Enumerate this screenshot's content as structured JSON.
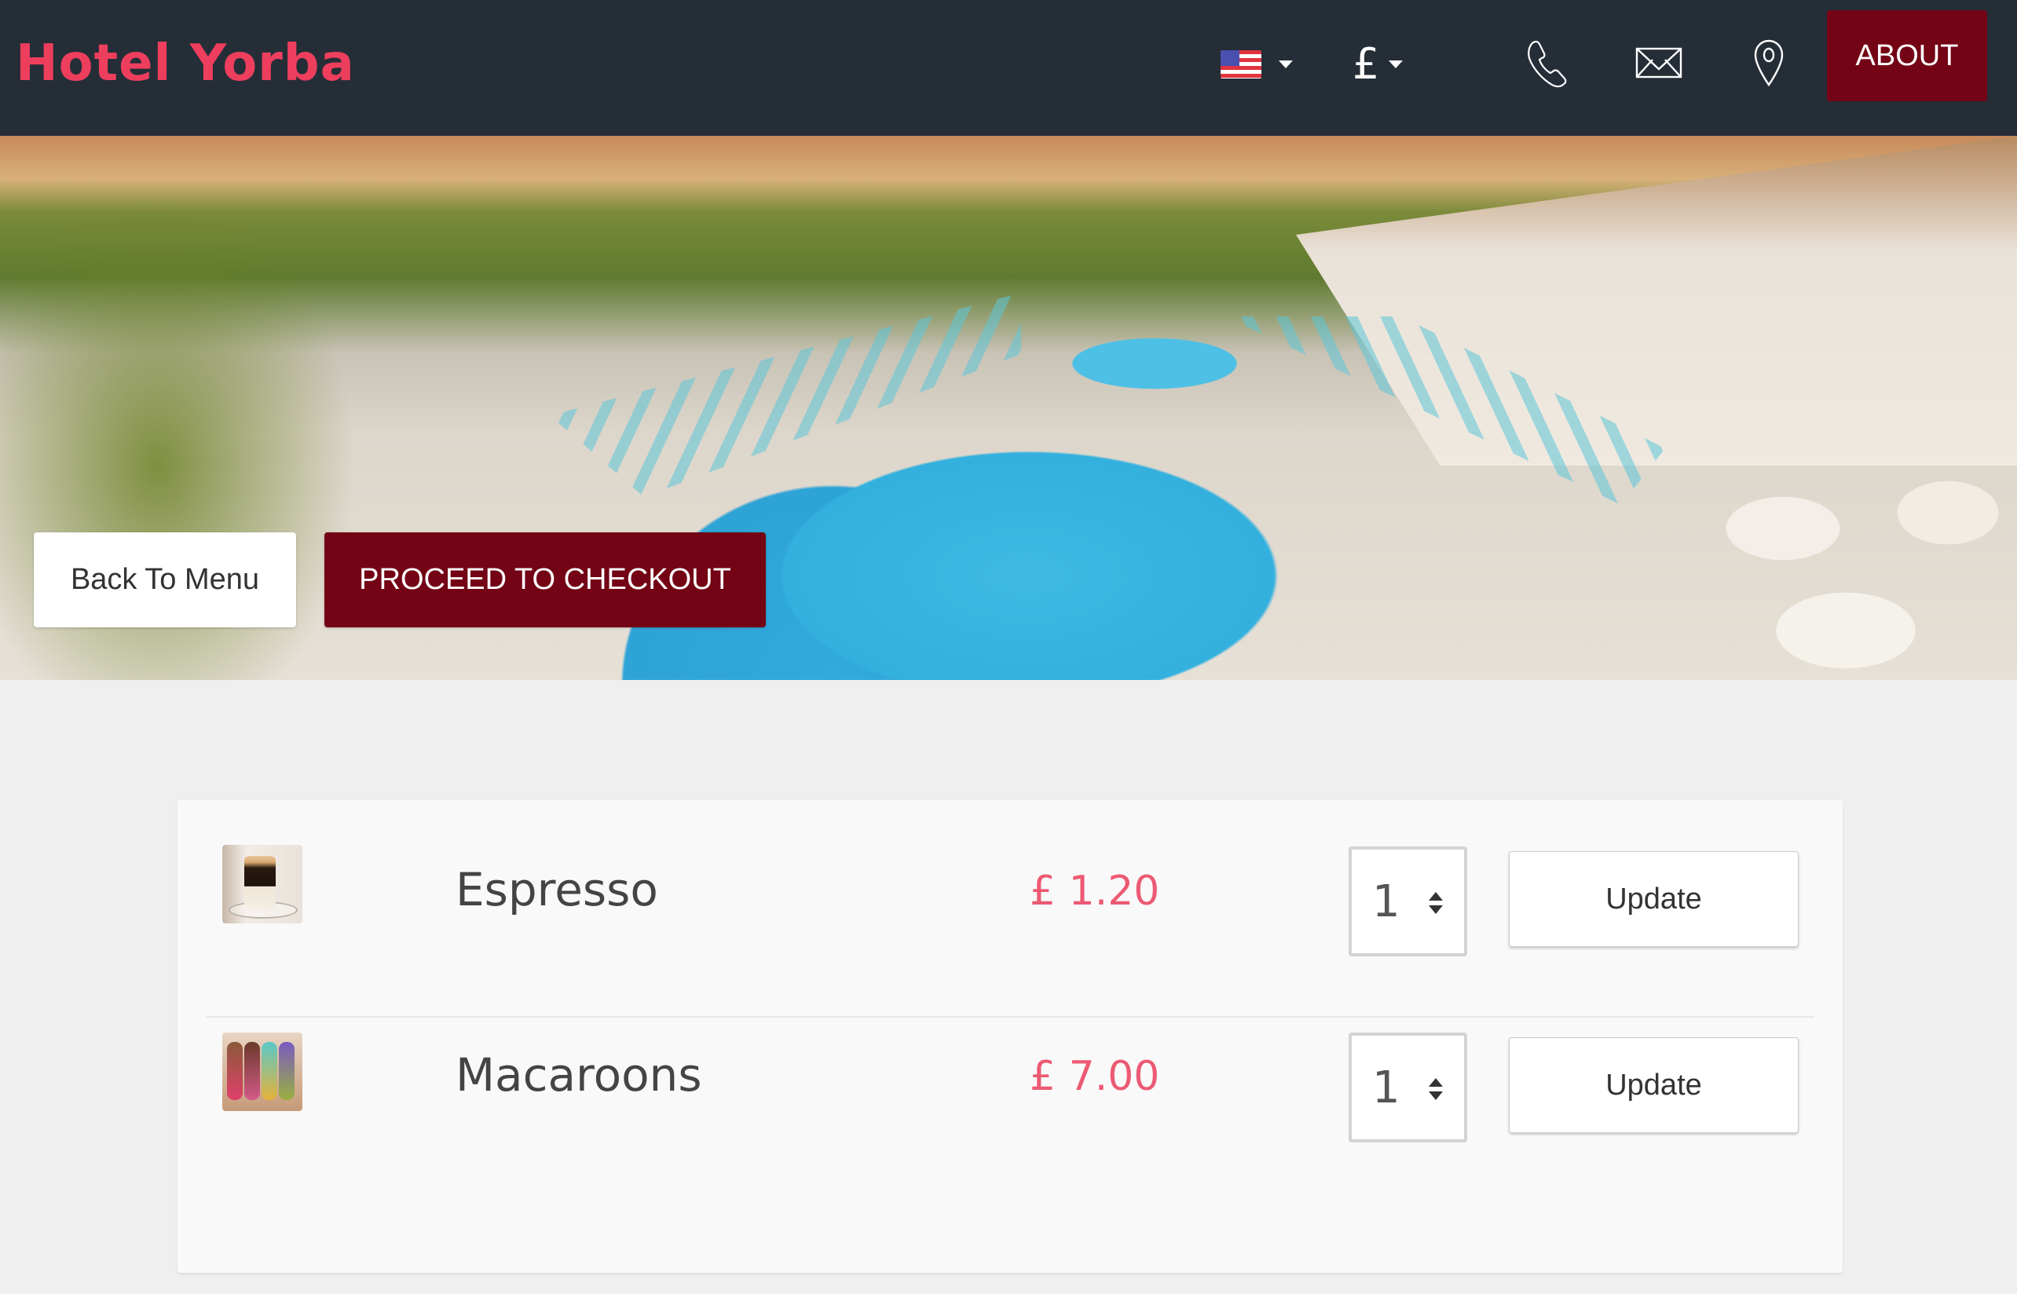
{
  "header": {
    "brand": "Hotel Yorba",
    "language_selector": {
      "flag": "us-flag-icon",
      "selected": "English (US)"
    },
    "currency_selector": {
      "selected": "£"
    },
    "icons": [
      "phone-icon",
      "mail-icon",
      "location-pin-icon"
    ],
    "about_label": "ABOUT"
  },
  "hero": {
    "back_label": "Back To Menu",
    "checkout_label": "PROCEED TO CHECKOUT"
  },
  "cart": {
    "items": [
      {
        "name": "Espresso",
        "price": "£ 1.20",
        "quantity": "1",
        "update_label": "Update",
        "image": "espresso-thumbnail"
      },
      {
        "name": "Macaroons",
        "price": "£ 7.00",
        "quantity": "1",
        "update_label": "Update",
        "image": "macaroons-thumbnail"
      }
    ]
  },
  "colors": {
    "header_bg": "#252d37",
    "brand": "#ee3e5e",
    "accent": "#730315",
    "price": "#ec5a73",
    "page_bg": "#efefef"
  }
}
